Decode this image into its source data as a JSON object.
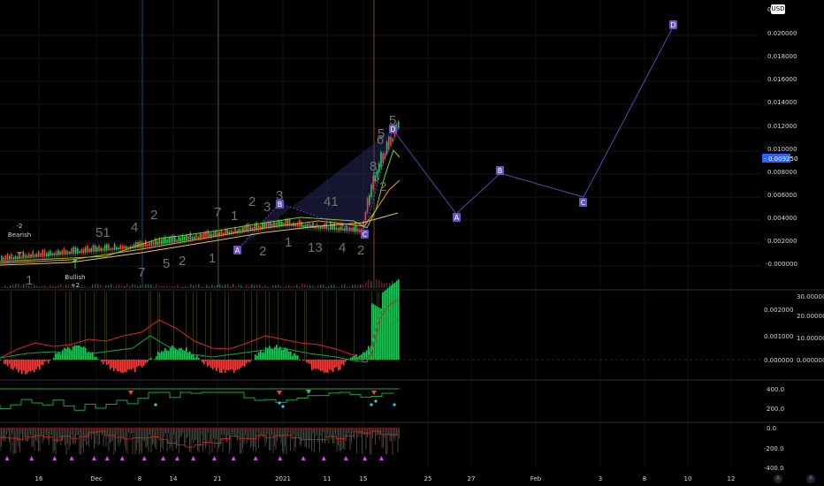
{
  "currency": "USD",
  "price_axis": {
    "labels": [
      "0.020000",
      "0.018000",
      "0.016000",
      "0.014000",
      "0.012000",
      "0.010000",
      "0.008000",
      "0.006000",
      "0.004000",
      "0.002000",
      "-0.000000"
    ],
    "current_price": "0.009250",
    "current_price_color": "#2962ff",
    "top_partial": "0."
  },
  "indicator_axes": {
    "macd_right": [
      "30.000000",
      "20.000000",
      "10.000000",
      "0.000000"
    ],
    "macd_left": [
      "0.002000",
      "0.001000",
      "0.000000"
    ],
    "osc": [
      "400.0",
      "200.0",
      "0.0",
      "-200.0",
      "-400.0"
    ]
  },
  "time_axis": [
    "16",
    "Dec",
    "8",
    "14",
    "21",
    "2021",
    "11",
    "15",
    "25",
    "27",
    "Feb",
    "3",
    "8",
    "10",
    "12"
  ],
  "annotations": {
    "bearish": {
      "value": "-2",
      "label": "Bearish"
    },
    "bullish": {
      "value": "+2",
      "label": "Bullish"
    }
  },
  "pattern_points": [
    "A",
    "B",
    "C",
    "D"
  ],
  "projection_points": [
    "A",
    "B",
    "C",
    "D"
  ],
  "wave_counts": [
    "51",
    "4",
    "2",
    "7",
    "1",
    "2",
    "3",
    "3",
    "41",
    "5",
    "2",
    "1",
    "7",
    "5",
    "2",
    "1",
    "2",
    "1",
    "13",
    "4",
    "2",
    "8",
    "6",
    "5",
    "5"
  ],
  "colors": {
    "bull": "#22c55e",
    "bear": "#ef4444",
    "pattern": "#5b5bd6",
    "projection": "#4b4fa8",
    "grid": "#131722"
  },
  "corner_buttons": [
    "A",
    "®"
  ]
}
